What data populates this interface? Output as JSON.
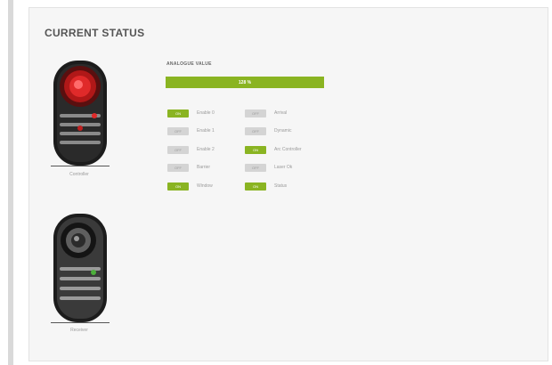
{
  "page": {
    "title": "CURRENT STATUS"
  },
  "devices": [
    {
      "label": "Controller",
      "state_color": "#d21e1e"
    },
    {
      "label": "Receiver",
      "state_color": "#4caf3a"
    }
  ],
  "analogue": {
    "label": "ANALOGUE VALUE",
    "value": "128 %"
  },
  "statuses": {
    "left": [
      {
        "badge": "ON",
        "state": "on",
        "label": "Enable 0"
      },
      {
        "badge": "OFF",
        "state": "off",
        "label": "Enable 1"
      },
      {
        "badge": "OFF",
        "state": "off",
        "label": "Enable 2"
      },
      {
        "badge": "OFF",
        "state": "off",
        "label": "Barrier"
      },
      {
        "badge": "ON",
        "state": "on",
        "label": "Window"
      }
    ],
    "right": [
      {
        "badge": "OFF",
        "state": "off",
        "label": "Arrival"
      },
      {
        "badge": "OFF",
        "state": "off",
        "label": "Dynamic"
      },
      {
        "badge": "ON",
        "state": "on",
        "label": "Arc Controller"
      },
      {
        "badge": "OFF",
        "state": "off",
        "label": "Laser Ok"
      },
      {
        "badge": "ON",
        "state": "on",
        "label": "Status"
      }
    ]
  },
  "colors": {
    "accent": "#8ab422",
    "inactive": "#d4d4d4",
    "alarm": "#d21e1e",
    "ok_led": "#4caf3a"
  }
}
